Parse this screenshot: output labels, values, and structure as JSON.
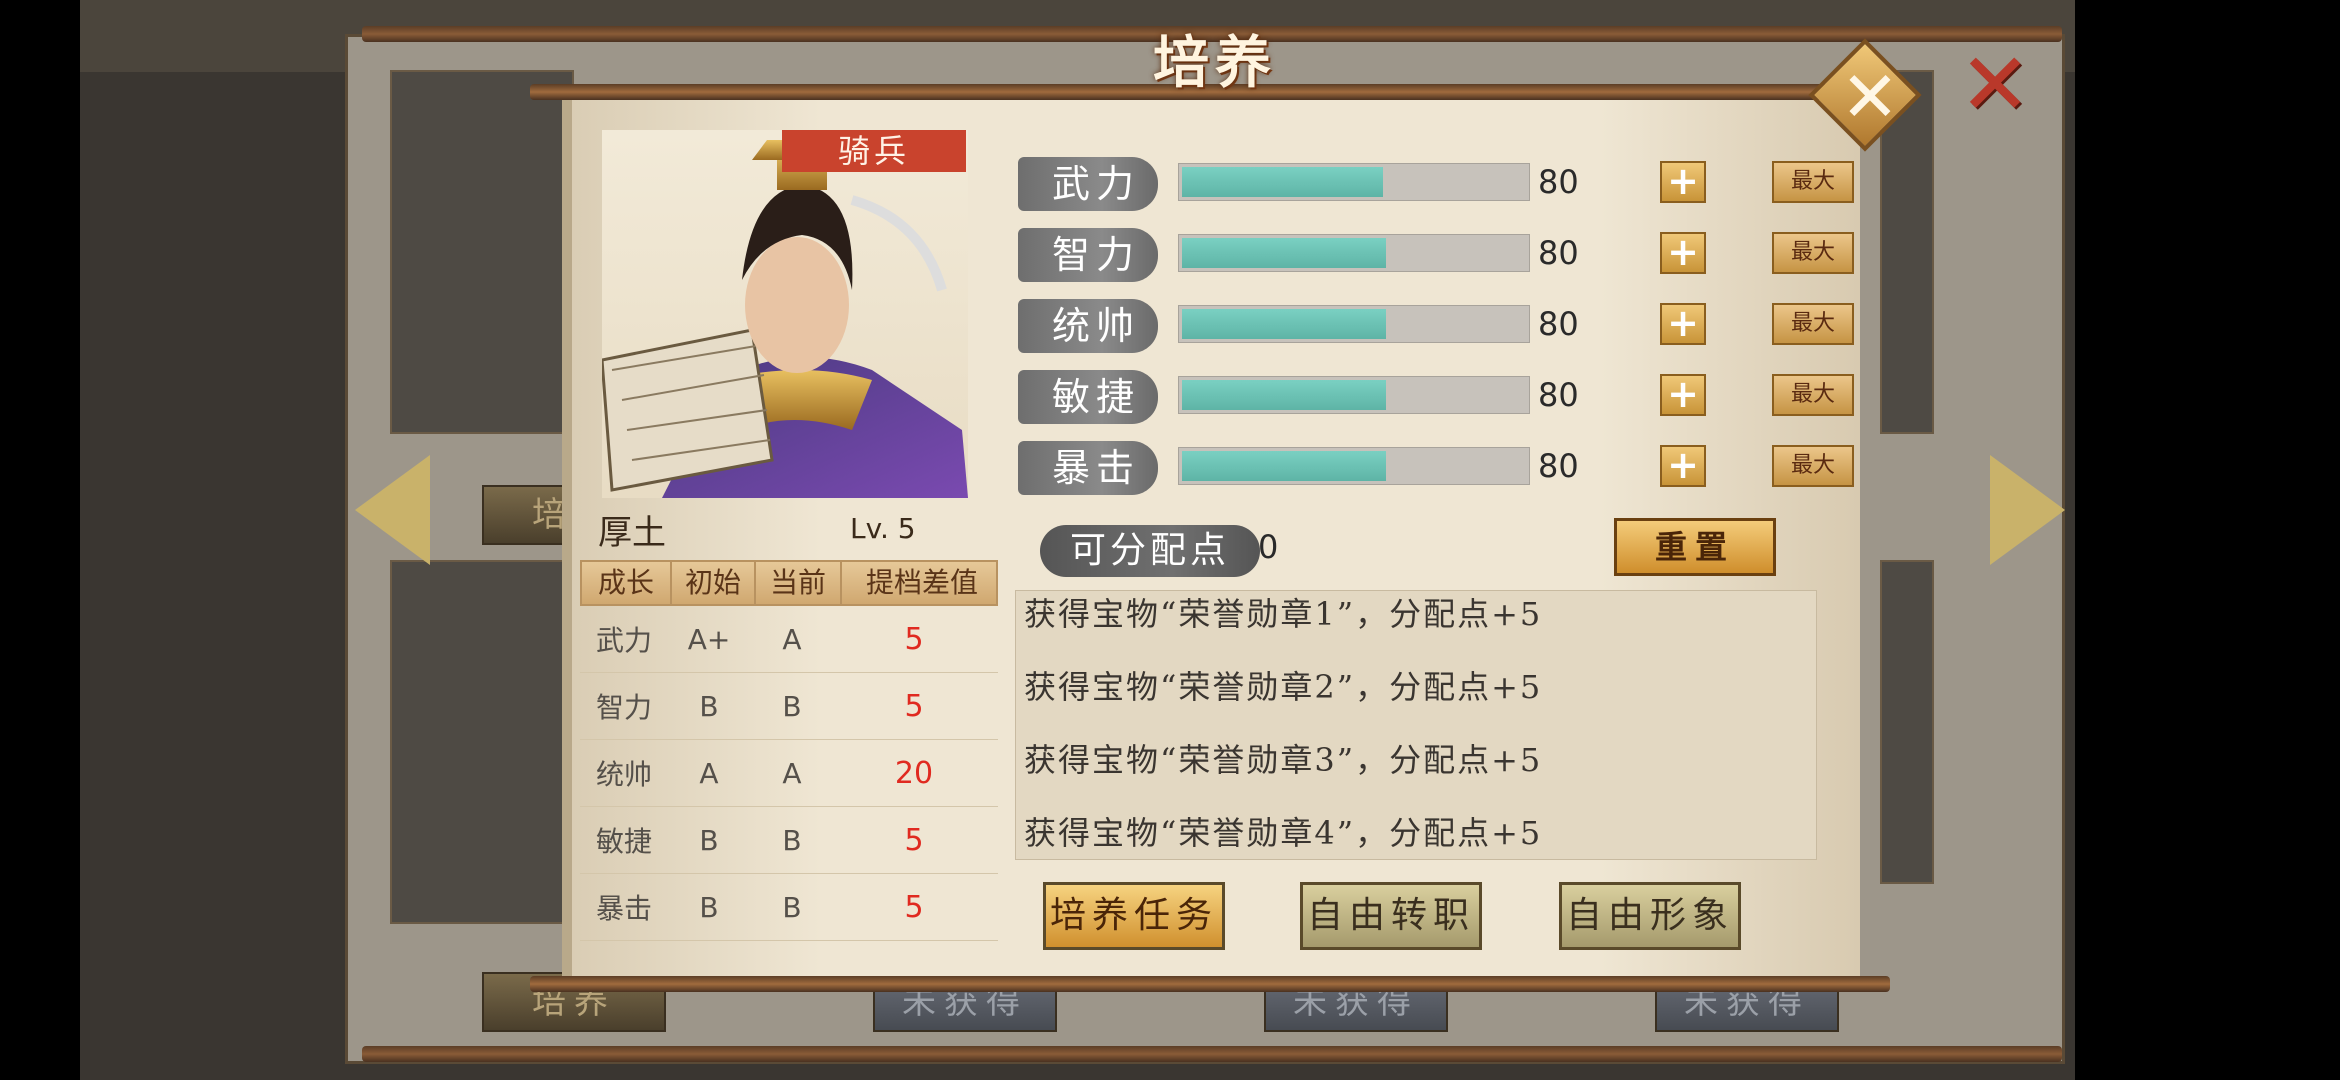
{
  "screen_title": "培养",
  "unit_type": "骑兵",
  "hero": {
    "name": "厚土",
    "level": "Lv. 5"
  },
  "attributes": [
    {
      "label": "武力",
      "value": "80",
      "fill": 0.58,
      "plus": "+",
      "max": "最大"
    },
    {
      "label": "智力",
      "value": "80",
      "fill": 0.59,
      "plus": "+",
      "max": "最大"
    },
    {
      "label": "统帅",
      "value": "80",
      "fill": 0.59,
      "plus": "+",
      "max": "最大"
    },
    {
      "label": "敏捷",
      "value": "80",
      "fill": 0.59,
      "plus": "+",
      "max": "最大"
    },
    {
      "label": "暴击",
      "value": "80",
      "fill": 0.59,
      "plus": "+",
      "max": "最大"
    }
  ],
  "points": {
    "label": "可分配点",
    "value": "0"
  },
  "reset_label": "重置",
  "growth_table": {
    "headers": [
      "成长",
      "初始",
      "当前",
      "提档差值"
    ],
    "rows": [
      [
        "武力",
        "A+",
        "A",
        "5"
      ],
      [
        "智力",
        "B",
        "B",
        "5"
      ],
      [
        "统帅",
        "A",
        "A",
        "20"
      ],
      [
        "敏捷",
        "B",
        "B",
        "5"
      ],
      [
        "暴击",
        "B",
        "B",
        "5"
      ]
    ]
  },
  "log": [
    "获得宝物“荣誉勋章1”，分配点+5",
    "获得宝物“荣誉勋章2”，分配点+5",
    "获得宝物“荣誉勋章3”，分配点+5",
    "获得宝物“荣誉勋章4”，分配点+5"
  ],
  "buttons": {
    "train_task": "培养任务",
    "job_change": "自由转职",
    "appearance": "自由形象"
  },
  "background_buttons": [
    "培养",
    "未获得",
    "未获得",
    "未获得"
  ],
  "colors": {
    "accent_gold": "#d0902e",
    "bar_fill": "#6ec2b4",
    "tag_red": "#c9432d",
    "diff_red": "#e02a20",
    "close_red": "#b9382a"
  },
  "icons": [
    "close-icon",
    "close-diamond-icon",
    "arrow-left-icon",
    "arrow-right-icon",
    "plus-icon"
  ]
}
